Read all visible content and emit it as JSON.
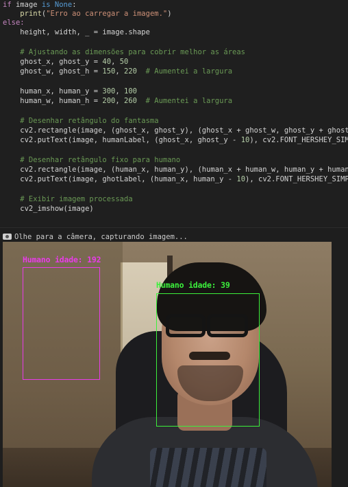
{
  "code": {
    "lines": {
      "l1_kw": "if",
      "l1_rest": " image ",
      "l1_is": "is",
      "l1_none": " None",
      "l1_colon": ":",
      "l2_fn": "print",
      "l2_open": "(",
      "l2_str": "\"Erro ao carregar a imagem.\"",
      "l2_close": ")",
      "l3": "else:",
      "l4": "    height, width, _ = image.shape",
      "l5": "    # Ajustando as dimensões para cobrir melhor as áreas",
      "l6_a": "    ghost_x, ghost_y = ",
      "l6_n1": "40",
      "l6_c": ", ",
      "l6_n2": "50",
      "l7_a": "    ghost_w, ghost_h = ",
      "l7_n1": "150",
      "l7_c": ", ",
      "l7_n2": "220",
      "l7_cm": "  # Aumentei a largura",
      "l8_a": "    human_x, human_y = ",
      "l8_n1": "300",
      "l8_c": ", ",
      "l8_n2": "100",
      "l9_a": "    human_w, human_h = ",
      "l9_n1": "200",
      "l9_c": ", ",
      "l9_n2": "260",
      "l9_cm": "  # Aumentei a largura",
      "l10": "    # Desenhar retângulo do fantasma",
      "l11": "    cv2.rectangle(image, (ghost_x, ghost_y), (ghost_x + ghost_w, ghost_y + ghost",
      "l12_a": "    cv2.putText(image, humanLabel, (ghost_x, ghost_y - ",
      "l12_n": "10",
      "l12_b": "), cv2.FONT_HERSHEY_SIM",
      "l13": "    # Desenhar retângulo fixo para humano",
      "l14": "    cv2.rectangle(image, (human_x, human_y), (human_x + human_w, human_y + human",
      "l15_a": "    cv2.putText(image, ghotLabel, (human_x, human_y - ",
      "l15_n": "10",
      "l15_b": "), cv2.FONT_HERSHEY_SIMP",
      "l16": "    # Exibir imagem processada",
      "l17": "    cv2_imshow(image)"
    }
  },
  "output": {
    "stdout": "Olhe para a câmera, capturando imagem...",
    "stdout_icon": "camera-icon",
    "webcam": {
      "ghost_label": "Humano idade: 192",
      "human_label": "Humano idade: 39",
      "ghost_color": "#e83ce8",
      "human_color": "#3cf03c"
    }
  }
}
